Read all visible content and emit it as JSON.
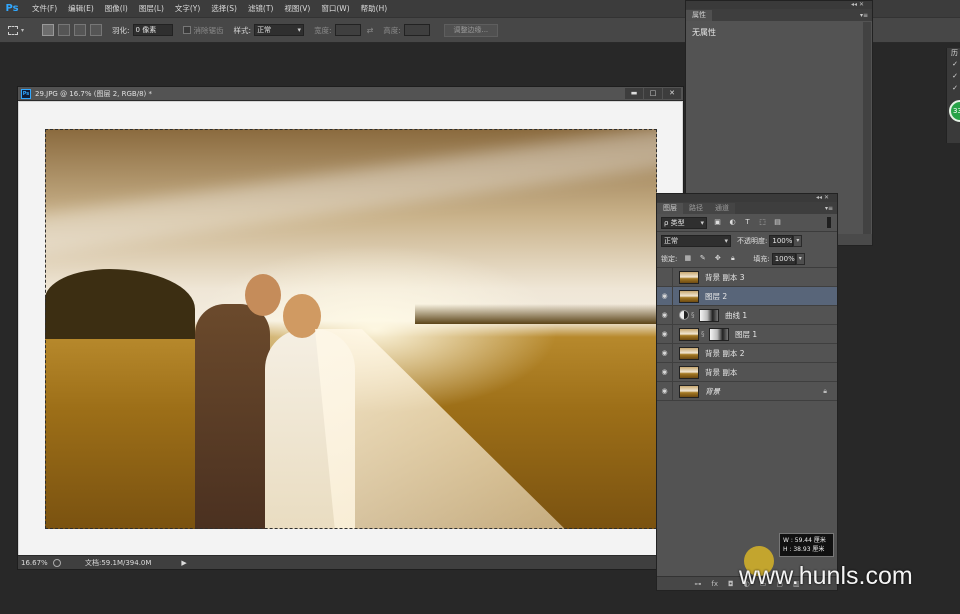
{
  "menubar": {
    "logo": "Ps",
    "items": [
      "文件(F)",
      "编辑(E)",
      "图像(I)",
      "图层(L)",
      "文字(Y)",
      "选择(S)",
      "滤镜(T)",
      "视图(V)",
      "窗口(W)",
      "帮助(H)"
    ]
  },
  "options": {
    "feather_label": "羽化:",
    "feather_value": "0 像素",
    "antialias_label": "消除锯齿",
    "style_label": "样式:",
    "style_value": "正常",
    "width_label": "宽度:",
    "height_label": "高度:",
    "refine_label": "调整边缘..."
  },
  "document": {
    "icon": "Ps",
    "title": "29.JPG @ 16.7% (图层 2, RGB/8) *",
    "zoom": "16.67%",
    "docinfo": "文档:59.1M/394.0M",
    "min": "▬",
    "max": "□",
    "close": "✕"
  },
  "properties": {
    "tab": "属性",
    "body": "无属性"
  },
  "layers_panel": {
    "tabs": [
      "图层",
      "路径",
      "通道"
    ],
    "filter_kind": "ρ 类型",
    "blend_mode": "正常",
    "opacity_label": "不透明度:",
    "opacity_value": "100%",
    "lock_label": "锁定:",
    "fill_label": "填充:",
    "fill_value": "100%",
    "layers": [
      {
        "name": "背景 副本 3",
        "visible": false,
        "selected": false
      },
      {
        "name": "图层 2",
        "visible": true,
        "selected": true
      },
      {
        "name": "曲线 1",
        "visible": true,
        "selected": false
      },
      {
        "name": "图层 1",
        "visible": true,
        "selected": false
      },
      {
        "name": "背景 副本 2",
        "visible": true,
        "selected": false
      },
      {
        "name": "背景 副本",
        "visible": true,
        "selected": false
      },
      {
        "name": "背景",
        "visible": true,
        "selected": false
      }
    ]
  },
  "dimension_tip": {
    "w": "W : 59.44 厘米",
    "h": "H : 38.93 厘米"
  },
  "side_strip": {
    "badge": "33"
  },
  "watermark": "www.hunls.com"
}
